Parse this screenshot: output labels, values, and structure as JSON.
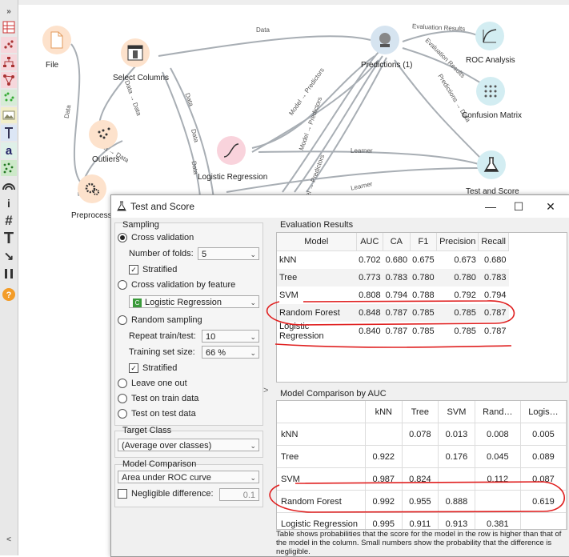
{
  "workflow": {
    "nodes": {
      "file": "File",
      "select_columns": "Select Columns",
      "outliers": "Outliers",
      "preprocess": "Preprocess",
      "logistic_regression": "Logistic Regression",
      "predictions": "Predictions (1)",
      "roc": "ROC Analysis",
      "confusion": "Confusion Matrix",
      "test_score": "Test and Score"
    },
    "edges": {
      "data": "Data",
      "eval_results": "Evaluation Results",
      "learner": "Learner",
      "model_predictors": "Model → Predictors",
      "predictions_data": "Predictions → Data",
      "data_data": "Data → Data"
    }
  },
  "toolbar": {
    "expand": "»",
    "items": [
      "table-icon",
      "scatter-icon",
      "tree-icon",
      "network-icon",
      "cluster-icon",
      "image-icon",
      "text-icon",
      "letter-a-icon",
      "dots-icon",
      "rainbow-icon",
      "info-icon",
      "hash-icon",
      "big-t-icon",
      "arrow-icon",
      "pause-icon",
      "help-icon"
    ]
  },
  "dialog": {
    "title": "Test and Score",
    "controls": {
      "minimize": "—",
      "maximize": "☐",
      "close": "✕"
    },
    "sampling": {
      "title": "Sampling",
      "cross_validation": "Cross validation",
      "folds_label": "Number of folds:",
      "folds_value": "5",
      "stratified1": "Stratified",
      "cv_by_feature": "Cross validation by feature",
      "feature_value": "Logistic Regression",
      "feature_badge": "C",
      "random_sampling": "Random sampling",
      "repeat_label": "Repeat train/test:",
      "repeat_value": "10",
      "train_size_label": "Training set size:",
      "train_size_value": "66 %",
      "stratified2": "Stratified",
      "leave_one_out": "Leave one out",
      "test_on_train": "Test on train data",
      "test_on_test": "Test on test data"
    },
    "target": {
      "title": "Target Class",
      "value": "(Average over classes)"
    },
    "comparison": {
      "title": "Model Comparison",
      "value": "Area under ROC curve",
      "negligible_label": "Negligible difference:",
      "negligible_value": "0.1"
    },
    "collapse_arrow": ">",
    "evaluation": {
      "title": "Evaluation Results",
      "columns": [
        "Model",
        "AUC",
        "CA",
        "F1",
        "Precision",
        "Recall"
      ],
      "rows": [
        [
          "kNN",
          "0.702",
          "0.680",
          "0.675",
          "0.673",
          "0.680"
        ],
        [
          "Tree",
          "0.773",
          "0.783",
          "0.780",
          "0.780",
          "0.783"
        ],
        [
          "SVM",
          "0.808",
          "0.794",
          "0.788",
          "0.792",
          "0.794"
        ],
        [
          "Random Forest",
          "0.848",
          "0.787",
          "0.785",
          "0.785",
          "0.787"
        ],
        [
          "Logistic Regression",
          "0.840",
          "0.787",
          "0.785",
          "0.785",
          "0.787"
        ]
      ]
    },
    "model_comparison": {
      "title": "Model Comparison by AUC",
      "columns": [
        "",
        "kNN",
        "Tree",
        "SVM",
        "Rand…",
        "Logis…"
      ],
      "rows": [
        [
          "kNN",
          "",
          "0.078",
          "0.013",
          "0.008",
          "0.005"
        ],
        [
          "Tree",
          "0.922",
          "",
          "0.176",
          "0.045",
          "0.089"
        ],
        [
          "SVM",
          "0.987",
          "0.824",
          "",
          "0.112",
          "0.087"
        ],
        [
          "Random Forest",
          "0.992",
          "0.955",
          "0.888",
          "",
          "0.619"
        ],
        [
          "Logistic Regression",
          "0.995",
          "0.911",
          "0.913",
          "0.381",
          ""
        ]
      ],
      "note": "Table shows probabilities that the score for the model in the row is higher than that of the model in the column. Small numbers show the probability that the difference is negligible."
    }
  }
}
